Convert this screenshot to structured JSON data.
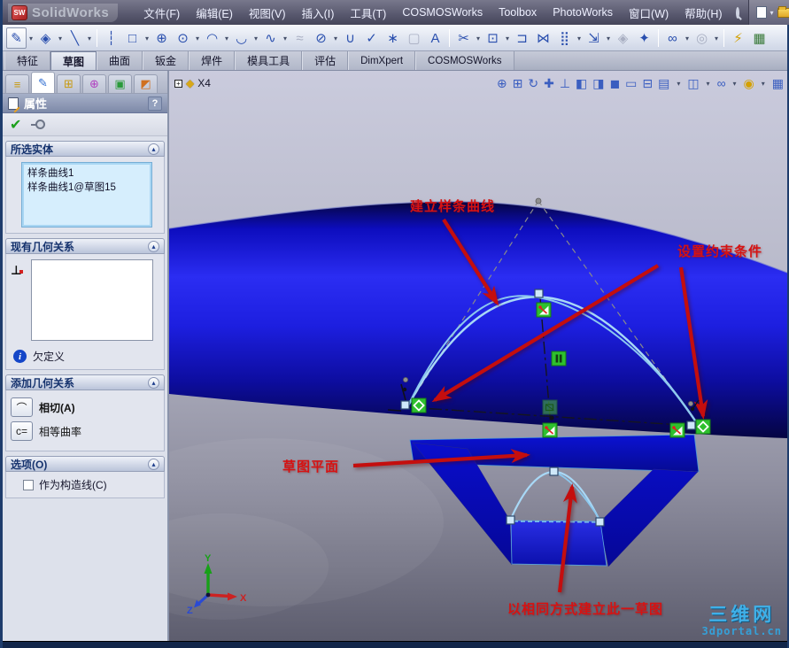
{
  "window": {
    "app_name": "SolidWorks",
    "logo_badge": "SW"
  },
  "glyphs": {
    "caret": "▾",
    "plus": "+"
  },
  "menu": {
    "items": [
      "文件(F)",
      "编辑(E)",
      "视图(V)",
      "插入(I)",
      "工具(T)",
      "COSMOSWorks",
      "Toolbox",
      "PhotoWorks",
      "窗口(W)",
      "帮助(H)"
    ]
  },
  "titlebar_icons": [
    {
      "name": "new-document-icon"
    },
    {
      "name": "open-icon"
    },
    {
      "name": "save-icon"
    },
    {
      "name": "print-icon"
    }
  ],
  "sketch_toolbar": {
    "icons": [
      {
        "name": "sketch",
        "glyph": "✎"
      },
      {
        "name": "smart-dimension",
        "glyph": "◈"
      },
      {
        "name": "line",
        "glyph": "╲"
      },
      {
        "name": "centerline",
        "glyph": "┆"
      },
      {
        "name": "rectangle",
        "glyph": "□"
      },
      {
        "name": "polygon",
        "glyph": "⊕"
      },
      {
        "name": "circle",
        "glyph": "⊙"
      },
      {
        "name": "centerpoint-arc",
        "glyph": "◠"
      },
      {
        "name": "tangent-arc",
        "glyph": "◡"
      },
      {
        "name": "spline",
        "glyph": "∿"
      },
      {
        "name": "freeform-spline",
        "glyph": "≈"
      },
      {
        "name": "ellipse",
        "glyph": "⊘"
      },
      {
        "name": "parabola",
        "glyph": "∪"
      },
      {
        "name": "fit-spline",
        "glyph": "✓"
      },
      {
        "name": "point",
        "glyph": "∗"
      },
      {
        "name": "segment",
        "glyph": "▢"
      },
      {
        "name": "text",
        "glyph": "A"
      },
      {
        "name": "trim-entities",
        "glyph": "✂"
      },
      {
        "name": "convert-entities",
        "glyph": "⊡"
      },
      {
        "name": "offset-entities",
        "glyph": "⊐"
      },
      {
        "name": "mirror-entities",
        "glyph": "⋈"
      },
      {
        "name": "linear-pattern",
        "glyph": "⣿"
      },
      {
        "name": "move-entities",
        "glyph": "⇲"
      },
      {
        "name": "sketch-tools",
        "glyph": "◈"
      },
      {
        "name": "rapid-sketch",
        "glyph": "✦"
      },
      {
        "name": "display-relations",
        "glyph": "∞"
      },
      {
        "name": "quick-snaps",
        "glyph": "◎"
      },
      {
        "name": "instant-2d",
        "glyph": "⚡"
      },
      {
        "name": "sketch-picture",
        "glyph": "▦"
      }
    ]
  },
  "tabs": {
    "items": [
      "特征",
      "草图",
      "曲面",
      "钣金",
      "焊件",
      "模具工具",
      "评估",
      "DimXpert",
      "COSMOSWorks"
    ],
    "active": "草图"
  },
  "pm_tabs": [
    {
      "name": "featuremanager-tree-tab",
      "glyph": "≡",
      "color": "#c89a10"
    },
    {
      "name": "propertymanager-tab",
      "glyph": "✎",
      "color": "#2a6ad0"
    },
    {
      "name": "configurationmanager-tab",
      "glyph": "⊞",
      "color": "#c89a10"
    },
    {
      "name": "dimxpertmanager-tab",
      "glyph": "⊕",
      "color": "#b040c0"
    },
    {
      "name": "cosmosworks-manager-tab",
      "glyph": "▣",
      "color": "#2a9a3a"
    },
    {
      "name": "appearances-tab",
      "glyph": "◩",
      "color": "#d07020"
    }
  ],
  "property_panel": {
    "title": "属性",
    "help": "?",
    "confirm_check": "✔",
    "collapse_glyph": "▴",
    "sections": {
      "selected_entities": {
        "title": "所选实体",
        "items": [
          "样条曲线1",
          "样条曲线1@草图15"
        ]
      },
      "existing_relations": {
        "title": "现有几何关系",
        "status": "欠定义",
        "status_icon": "i"
      },
      "add_relations": {
        "title": "添加几何关系",
        "buttons": [
          {
            "name": "tangent",
            "glyph": "⌒",
            "label": "相切(A)",
            "selected": true
          },
          {
            "name": "equal-curvature",
            "glyph": "c=",
            "label": "相等曲率",
            "selected": false
          }
        ]
      },
      "options": {
        "title": "选项(O)",
        "checkbox_label": "作为构造线(C)",
        "checked": false
      }
    }
  },
  "feature_tree": {
    "root": "X4",
    "expand": "+"
  },
  "view_toolbar": {
    "icons": [
      {
        "name": "zoom-to-fit",
        "glyph": "⊕"
      },
      {
        "name": "zoom-to-area",
        "glyph": "⊞"
      },
      {
        "name": "rotate-view",
        "glyph": "↻"
      },
      {
        "name": "pan",
        "glyph": "✚"
      },
      {
        "name": "normal-to",
        "glyph": "⊥"
      },
      {
        "name": "section-view",
        "glyph": "◧"
      },
      {
        "name": "realview",
        "glyph": "◨"
      },
      {
        "name": "shaded-with-edges",
        "glyph": "◼"
      },
      {
        "name": "single-view",
        "glyph": "▭"
      },
      {
        "name": "split-view",
        "glyph": "⊟"
      },
      {
        "name": "view-orientation",
        "glyph": "▤"
      },
      {
        "name": "display-style",
        "glyph": "◫"
      },
      {
        "name": "hide-show-items",
        "glyph": "∞"
      },
      {
        "name": "apply-scene",
        "glyph": "◉"
      },
      {
        "name": "view-settings",
        "glyph": "▦"
      }
    ]
  },
  "annotations": {
    "create_spline": "建立样条曲线",
    "set_constraints": "设置约束条件",
    "sketch_plane": "草图平面",
    "same_method": "以相同方式建立此一草图"
  },
  "triad": {
    "x": "X",
    "y": "Y",
    "z": "Z"
  },
  "watermark": {
    "line1": "三维网",
    "line2": "3dportal.cn"
  },
  "colors": {
    "annotation_red": "#d61212",
    "band_blue": "#1d1fe0",
    "spline_cyan": "#a8d8f6",
    "constraint_green": "#2ec02e"
  }
}
